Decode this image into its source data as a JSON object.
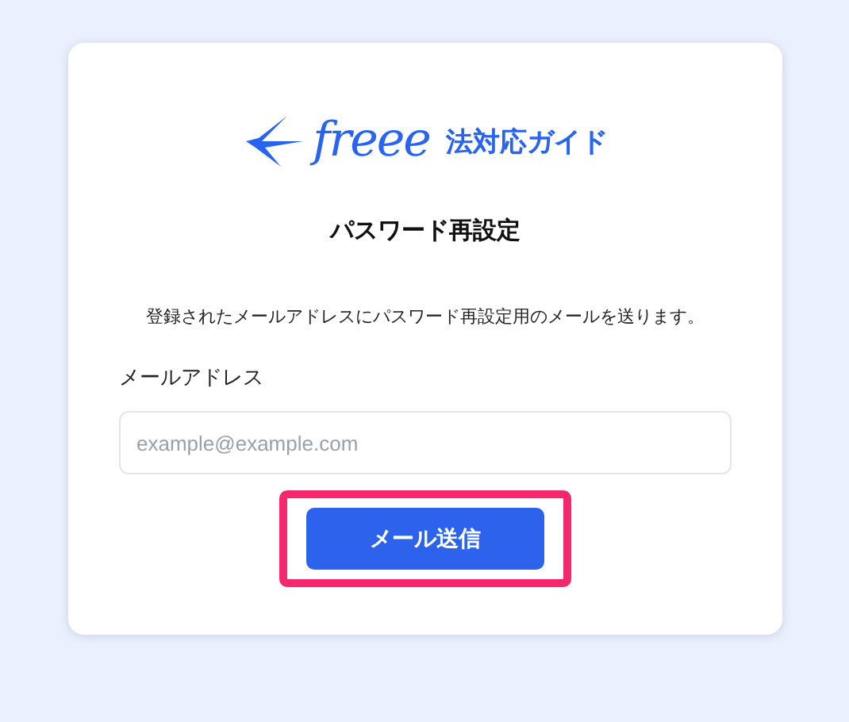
{
  "logo": {
    "wordmark": "freee",
    "subtitle": "法対応ガイド"
  },
  "title": "パスワード再設定",
  "description": "登録されたメールアドレスにパスワード再設定用のメールを送ります。",
  "email_field": {
    "label": "メールアドレス",
    "placeholder": "example@example.com"
  },
  "submit_button": {
    "label": "メール送信",
    "highlighted": true
  }
}
